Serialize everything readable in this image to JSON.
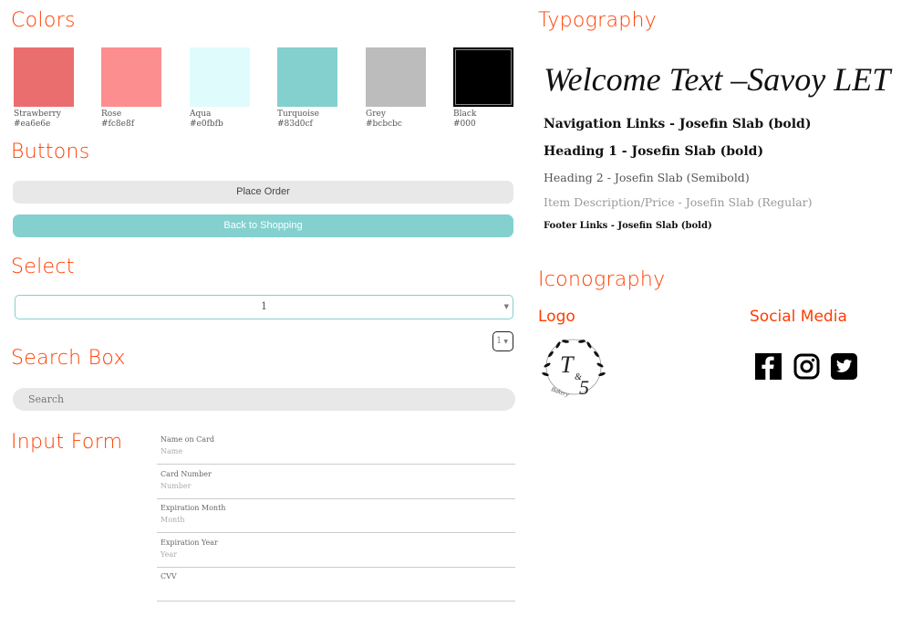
{
  "colors": {
    "title": "Colors",
    "swatches": [
      {
        "name": "Strawberry",
        "hex": "#ea6e6e"
      },
      {
        "name": "Rose",
        "hex": "#fc8e8f"
      },
      {
        "name": "Aqua",
        "hex": "#e0fbfb"
      },
      {
        "name": "Turquoise",
        "hex": "#83d0cf"
      },
      {
        "name": "Grey",
        "hex": "#bcbcbc"
      },
      {
        "name": "Black",
        "hex": "#000"
      }
    ]
  },
  "buttons": {
    "title": "Buttons",
    "place_order": "Place Order",
    "back_to_shopping": "Back to Shopping"
  },
  "select": {
    "title": "Select",
    "value": "1",
    "small_value": "1"
  },
  "search": {
    "title": "Search Box",
    "placeholder": "Search"
  },
  "form": {
    "title": "Input Form",
    "fields": [
      {
        "label": "Name on Card",
        "placeholder": "Name"
      },
      {
        "label": "Card Number",
        "placeholder": "Number"
      },
      {
        "label": "Expiration Month",
        "placeholder": "Month"
      },
      {
        "label": "Expiration Year",
        "placeholder": "Year"
      },
      {
        "label": "CVV",
        "placeholder": ""
      }
    ]
  },
  "typography": {
    "title": "Typography",
    "welcome": "Welcome Text –Savoy LET",
    "nav": "Navigation Links - Josefin Slab (bold)",
    "h1": "Heading 1 - Josefin Slab (bold)",
    "h2": "Heading 2 - Josefin Slab (Semibold)",
    "item": "Item Description/Price - Josefin Slab (Regular)",
    "footer": "Footer Links - Josefin Slab (bold)"
  },
  "iconography": {
    "title": "Iconography",
    "logo_title": "Logo",
    "logo_text": "T & S Bakery",
    "social_title": "Social Media",
    "social": [
      "facebook-icon",
      "instagram-icon",
      "twitter-icon"
    ]
  },
  "accent": "#ff3d00"
}
